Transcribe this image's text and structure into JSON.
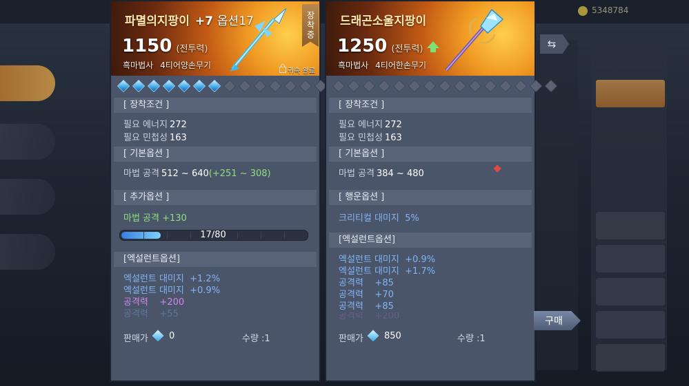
{
  "background": {
    "left_tabs": [
      "",
      "",
      "",
      "",
      ""
    ],
    "gold_value": "5348784"
  },
  "left_item": {
    "name": "파멸의지팡이",
    "enhance": "+7",
    "option_count": "옵션17",
    "equipped_badge": "장착중",
    "power": "1150",
    "power_label": "(전투력)",
    "class": "흑마법사",
    "tier_type": "4티어양손무기",
    "bind_status": "귀속 완료",
    "gems_filled": 7,
    "gems_total": 15,
    "sections": {
      "requirements": {
        "title": "[ 장착조건 ]",
        "rows": [
          {
            "label": "필요 에너지",
            "value": "272"
          },
          {
            "label": "필요 민첩성",
            "value": "163"
          }
        ]
      },
      "base": {
        "title": "[ 기본옵션 ]",
        "label": "마법 공격",
        "value": "512 ~ 640",
        "bonus": "(+251 ~ 308)"
      },
      "extra": {
        "title": "[ 추가옵션 ]",
        "label": "마법 공격",
        "value": "+130",
        "progress_text": "17/80",
        "progress": 0.2125
      },
      "excellent": {
        "title": "[엑설런트옵션]",
        "rows": [
          {
            "label": "엑설런트 대미지",
            "value": "+1.2%"
          },
          {
            "label": "엑설런트 대미지",
            "value": "+0.9%"
          },
          {
            "label": "공격력",
            "value": "+200"
          },
          {
            "label": "공격력",
            "value": "+55"
          }
        ]
      }
    },
    "price_label": "판매가",
    "price": "0",
    "qty": "수량 :1"
  },
  "right_item": {
    "name": "드래곤소울지팡이",
    "power": "1250",
    "power_label": "(전투력)",
    "class": "흑마법사",
    "tier_type": "4티어한손무기",
    "gems_filled": 0,
    "gems_total": 15,
    "sections": {
      "requirements": {
        "title": "[ 장착조건 ]",
        "rows": [
          {
            "label": "필요 에너지",
            "value": "272"
          },
          {
            "label": "필요 민첩성",
            "value": "163"
          }
        ]
      },
      "base": {
        "title": "[ 기본옵션 ]",
        "label": "마법 공격",
        "value": "384 ~ 480"
      },
      "luck": {
        "title": "[ 행운옵션 ]",
        "label": "크리티컬 대미지",
        "value": "5%"
      },
      "excellent": {
        "title": "[엑설런트옵션]",
        "rows": [
          {
            "label": "엑설런트 대미지",
            "value": "+0.9%"
          },
          {
            "label": "엑설런트 대미지",
            "value": "+1.7%"
          },
          {
            "label": "공격력",
            "value": "+85"
          },
          {
            "label": "공격력",
            "value": "+70"
          },
          {
            "label": "공격력",
            "value": "+85"
          },
          {
            "label": "공격력",
            "value": "+200"
          }
        ]
      }
    },
    "price_label": "판매가",
    "price": "850",
    "qty": "수량 :1"
  },
  "buttons": {
    "buy": "구매",
    "swap": "⇆"
  },
  "colors": {
    "bonus_green": "#8ee07e",
    "excellent_blue": "#82b4f4",
    "excellent_purple": "#d087e8",
    "gem_blue": "#3aa5e8"
  }
}
